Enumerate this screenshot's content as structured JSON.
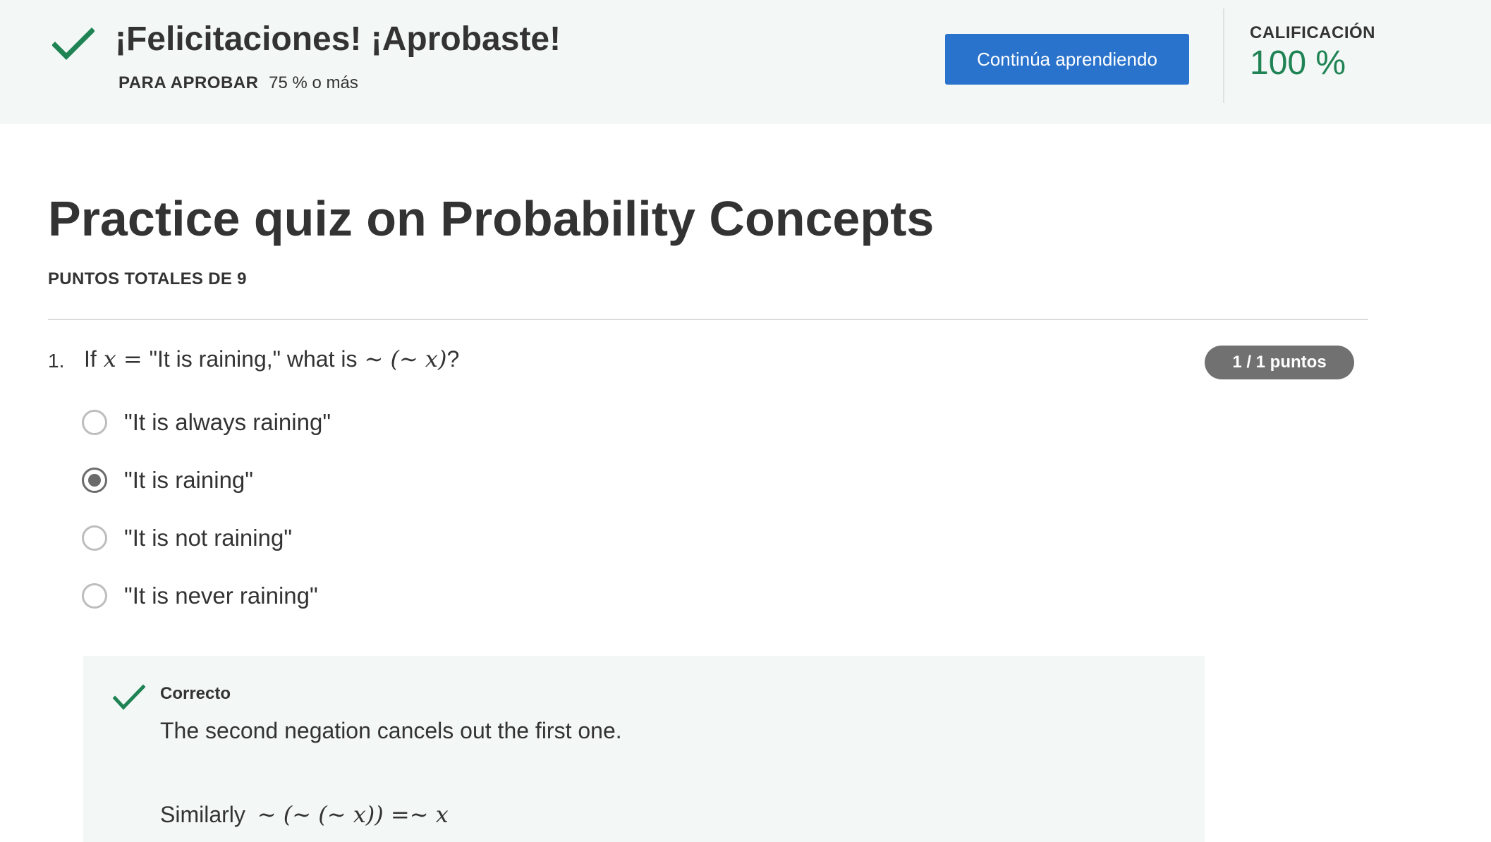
{
  "banner": {
    "title": "¡Felicitaciones! ¡Aprobaste!",
    "pass_label": "PARA APROBAR",
    "pass_value": "75 % o más",
    "continue_label": "Continúa aprendiendo",
    "grade_label": "CALIFICACIÓN",
    "grade_value": "100 %",
    "check_icon": "check-icon",
    "accent_color": "#1f8354",
    "button_color": "#2a73cc"
  },
  "quiz": {
    "title": "Practice quiz on Probability Concepts",
    "points_total": "PUNTOS TOTALES DE 9"
  },
  "question": {
    "number": "1.",
    "text_if": "If",
    "math_x": "x",
    "math_eq": "=",
    "text_quote": "\"It is raining,\" what is",
    "math_expr": "∼ (∼ x)",
    "text_qmark": "?",
    "points_badge": "1 / 1 puntos",
    "options": [
      {
        "label": "\"It is always raining\"",
        "selected": false
      },
      {
        "label": "\"It is raining\"",
        "selected": true
      },
      {
        "label": "\"It is not raining\"",
        "selected": false
      },
      {
        "label": "\"It is never raining\"",
        "selected": false
      }
    ]
  },
  "feedback": {
    "title": "Correcto",
    "text": "The second negation cancels out the first one.",
    "similarly": "Similarly",
    "similarly_math": "∼ (∼ (∼ x)) =∼ x"
  }
}
